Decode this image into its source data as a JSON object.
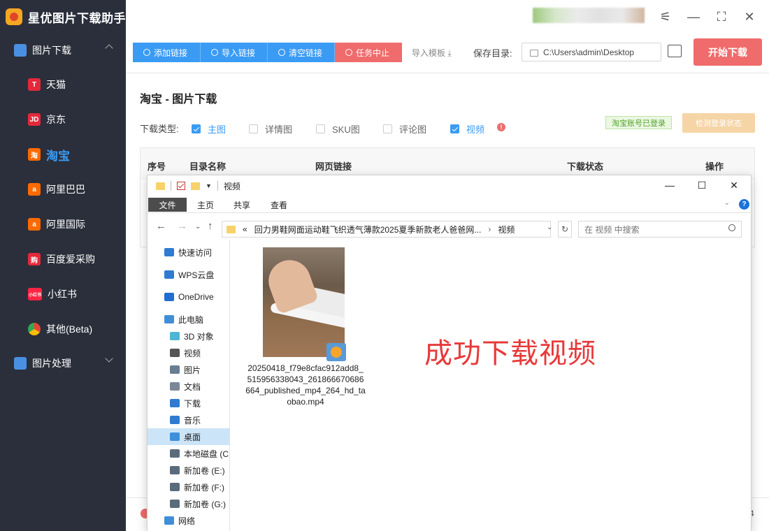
{
  "app": {
    "title": "星优图片下载助手",
    "brand_color": "#f5a623"
  },
  "sidebar": {
    "groups": [
      {
        "label": "图片下载",
        "expanded": true
      },
      {
        "label": "图片处理",
        "expanded": false
      }
    ],
    "items": [
      {
        "label": "天猫",
        "icon": "T",
        "color": "#e4293a"
      },
      {
        "label": "京东",
        "icon": "JD",
        "color": "#e4293a"
      },
      {
        "label": "淘宝",
        "icon": "淘",
        "color": "#ff6a00",
        "active": true
      },
      {
        "label": "阿里巴巴",
        "icon": "a",
        "color": "#ff6a00"
      },
      {
        "label": "阿里国际",
        "icon": "a",
        "color": "#ff6a00"
      },
      {
        "label": "百度爱采购",
        "icon": "购",
        "color": "#e4293a"
      },
      {
        "label": "小红书",
        "icon": "小红书",
        "color": "#ff2442"
      },
      {
        "label": "其他(Beta)",
        "icon": "chrome-icon",
        "color": "#4285f4"
      }
    ]
  },
  "toolbar": {
    "add_link": "添加链接",
    "import_link": "导入链接",
    "clear_link": "清空链接",
    "stop_task": "任务中止",
    "import_template": "导入模板",
    "save_dir_label": "保存目录:",
    "save_dir_value": "C:\\Users\\admin\\Desktop",
    "start_download": "开始下载"
  },
  "page": {
    "title": "淘宝 - 图片下载",
    "download_type_label": "下载类型:",
    "types": [
      {
        "label": "主图",
        "checked": true
      },
      {
        "label": "详情图",
        "checked": false
      },
      {
        "label": "SKU图",
        "checked": false
      },
      {
        "label": "评论图",
        "checked": false
      },
      {
        "label": "视频",
        "checked": true
      }
    ],
    "login_status": "淘宝账号已登录",
    "check_login": "检测登录状态"
  },
  "table": {
    "headers": [
      "序号",
      "目录名称",
      "网页链接",
      "下载状态",
      "操作"
    ]
  },
  "footer": {
    "corner_text": "4"
  },
  "explorer": {
    "title": "视频",
    "ribbon_tabs": [
      "文件",
      "主页",
      "共享",
      "查看"
    ],
    "breadcrumb": [
      "«",
      "回力男鞋网面运动鞋飞织透气薄款2025夏季新款老人爸爸网...",
      "视频"
    ],
    "search_placeholder": "在 视频 中搜索",
    "nav_items": [
      {
        "label": "快速访问",
        "icon": "star-icon",
        "color": "#2f7bd1"
      },
      {
        "label": "WPS云盘",
        "icon": "cloud-icon",
        "color": "#2f7bd1"
      },
      {
        "label": "OneDrive",
        "icon": "onedrive-icon",
        "color": "#1e6fd0"
      },
      {
        "label": "此电脑",
        "icon": "computer-icon",
        "color": "#3d8fd9"
      },
      {
        "label": "3D 对象",
        "icon": "cube-icon",
        "color": "#4fb4d8"
      },
      {
        "label": "视频",
        "icon": "film-icon",
        "color": "#555555"
      },
      {
        "label": "图片",
        "icon": "picture-icon",
        "color": "#6a7d92"
      },
      {
        "label": "文档",
        "icon": "document-icon",
        "color": "#7a8796"
      },
      {
        "label": "下载",
        "icon": "download-icon",
        "color": "#2f7bd1"
      },
      {
        "label": "音乐",
        "icon": "music-icon",
        "color": "#2f7bd1"
      },
      {
        "label": "桌面",
        "icon": "desktop-icon",
        "color": "#3d8fd9",
        "selected": true
      },
      {
        "label": "本地磁盘 (C",
        "icon": "drive-icon",
        "color": "#5a6b7c"
      },
      {
        "label": "新加卷 (E:)",
        "icon": "drive-icon",
        "color": "#5a6b7c"
      },
      {
        "label": "新加卷 (F:)",
        "icon": "drive-icon",
        "color": "#5a6b7c"
      },
      {
        "label": "新加卷 (G:)",
        "icon": "drive-icon",
        "color": "#5a6b7c"
      },
      {
        "label": "网络",
        "icon": "network-icon",
        "color": "#3d8fd9"
      }
    ],
    "file": {
      "name": "20250418_f79e8cfac912add8_515956338043_261866670686664_published_mp4_264_hd_taobao.mp4"
    },
    "overlay_text": "成功下载视频"
  }
}
